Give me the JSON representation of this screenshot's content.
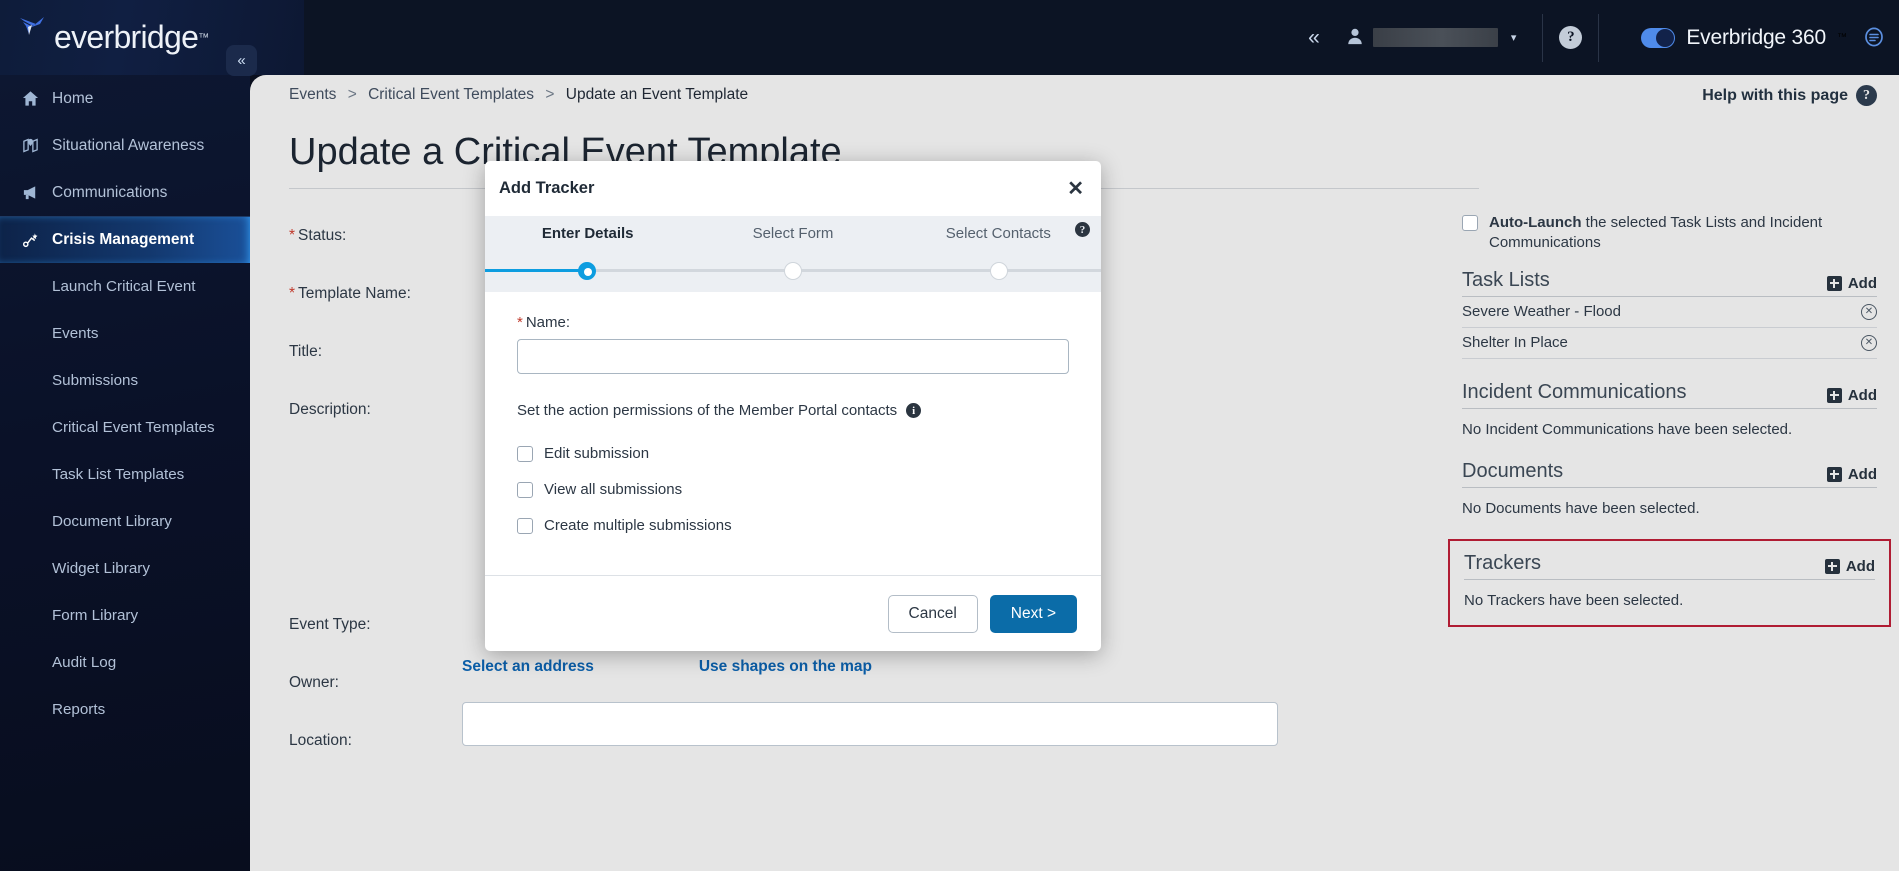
{
  "brand": {
    "logo_text": "everbridge",
    "logo_tm": "™",
    "accent_blue": "#0d9de0",
    "primary_button": "#0b6ca8",
    "highlight_red": "#b01c33",
    "sidebar_bg": "#0a1128",
    "content_bg": "#e5e5e5"
  },
  "topbar": {
    "collapse_label": "«",
    "user_menu_caret": "▾",
    "help_icon_label": "?",
    "product_toggle_label": "Everbridge 360",
    "product_toggle_tm": "™",
    "chat_icon_name": "chat-icon"
  },
  "sidebar": {
    "collapse_label": "«",
    "items": [
      {
        "label": "Home",
        "icon": "home-icon",
        "active": false
      },
      {
        "label": "Situational Awareness",
        "icon": "map-pin-icon",
        "active": false
      },
      {
        "label": "Communications",
        "icon": "megaphone-icon",
        "active": false
      },
      {
        "label": "Crisis Management",
        "icon": "crisis-icon",
        "active": true
      }
    ],
    "sub_items": [
      {
        "label": "Launch Critical Event"
      },
      {
        "label": "Events"
      },
      {
        "label": "Submissions"
      },
      {
        "label": "Critical Event Templates"
      },
      {
        "label": "Task List Templates"
      },
      {
        "label": "Document Library"
      },
      {
        "label": "Widget Library"
      },
      {
        "label": "Form Library"
      },
      {
        "label": "Audit Log"
      },
      {
        "label": "Reports"
      }
    ]
  },
  "breadcrumb": {
    "items": [
      "Events",
      "Critical Event Templates",
      "Update an Event Template"
    ],
    "separator": ">"
  },
  "header": {
    "help_with_page": "Help with this page",
    "help_icon_label": "?",
    "page_title": "Update a Critical Event Template"
  },
  "form": {
    "labels": [
      {
        "text": "Status:",
        "required": true
      },
      {
        "text": "Template Name:",
        "required": true
      },
      {
        "text": "Title:",
        "required": false
      },
      {
        "text": "Description:",
        "required": false
      },
      {
        "text": "Event Type:",
        "required": false
      },
      {
        "text": "Owner:",
        "required": false
      },
      {
        "text": "Location:",
        "required": false
      }
    ],
    "location_links": [
      "Select an address",
      "Use shapes on the map"
    ]
  },
  "right_panel": {
    "auto_launch_bold": "Auto-Launch",
    "auto_launch_rest": " the selected Task Lists and Incident Communications",
    "add_label": "Add",
    "remove_icon_label": "✕",
    "sections": [
      {
        "title": "Task Lists",
        "add_label": "Add",
        "items": [
          "Severe Weather - Flood",
          "Shelter In Place"
        ],
        "empty_text": "",
        "highlighted": false
      },
      {
        "title": "Incident Communications",
        "add_label": "Add",
        "items": [],
        "empty_text": "No Incident Communications have been selected.",
        "highlighted": false
      },
      {
        "title": "Documents",
        "add_label": "Add",
        "items": [],
        "empty_text": "No Documents have been selected.",
        "highlighted": false
      },
      {
        "title": "Trackers",
        "add_label": "Add",
        "items": [],
        "empty_text": "No Trackers have been selected.",
        "highlighted": true
      }
    ]
  },
  "modal": {
    "title": "Add Tracker",
    "close_label": "✕",
    "help_icon_label": "?",
    "steps": [
      {
        "label": "Enter Details",
        "state": "active"
      },
      {
        "label": "Select Form",
        "state": "pending"
      },
      {
        "label": "Select Contacts",
        "state": "pending"
      }
    ],
    "name_label": "Name:",
    "name_required_mark": "*",
    "name_value": "",
    "name_placeholder": "",
    "permissions_heading": "Set the action permissions of the Member Portal contacts",
    "permissions": [
      {
        "label": "Edit submission",
        "checked": false
      },
      {
        "label": "View all submissions",
        "checked": false
      },
      {
        "label": "Create multiple submissions",
        "checked": false
      }
    ],
    "cancel_label": "Cancel",
    "next_label": "Next >"
  }
}
